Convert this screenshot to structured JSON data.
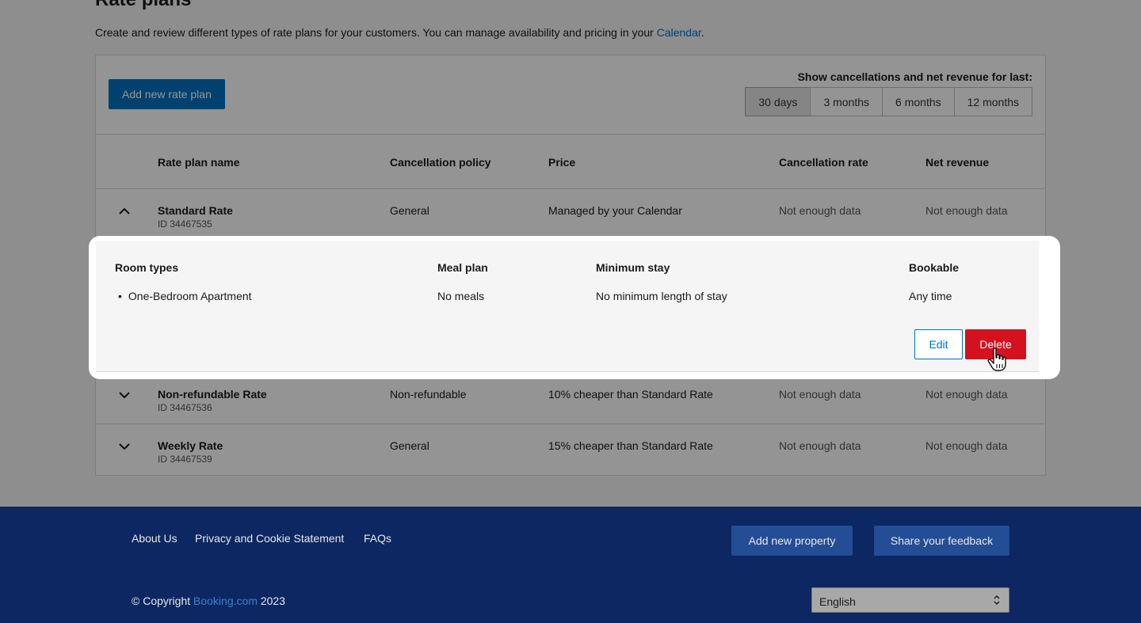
{
  "page": {
    "title": "Rate plans",
    "description_before": "Create and review different types of rate plans for your customers. You can manage availability and pricing in your ",
    "description_link": "Calendar",
    "description_after": "."
  },
  "toolbar": {
    "add_label": "Add new rate plan",
    "period_label": "Show cancellations and net revenue for last:",
    "periods": [
      "30 days",
      "3 months",
      "6 months",
      "12 months"
    ],
    "active_period": "30 days"
  },
  "table": {
    "headers": {
      "name": "Rate plan name",
      "policy": "Cancellation policy",
      "price": "Price",
      "rate": "Cancellation rate",
      "revenue": "Net revenue"
    },
    "rows": [
      {
        "name": "Standard Rate",
        "id": "ID 34467535",
        "policy": "General",
        "price": "Managed by your Calendar",
        "rate": "Not enough data",
        "revenue": "Not enough data",
        "expanded": true
      },
      {
        "name": "Non-refundable Rate",
        "id": "ID 34467536",
        "policy": "Non-refundable",
        "price": "10% cheaper than Standard Rate",
        "rate": "Not enough data",
        "revenue": "Not enough data",
        "expanded": false
      },
      {
        "name": "Weekly Rate",
        "id": "ID 34467539",
        "policy": "General",
        "price": "15% cheaper than Standard Rate",
        "rate": "Not enough data",
        "revenue": "Not enough data",
        "expanded": false
      }
    ]
  },
  "detail": {
    "headers": {
      "room_types": "Room types",
      "meal_plan": "Meal plan",
      "min_stay": "Minimum stay",
      "bookable": "Bookable"
    },
    "room_types": [
      "One-Bedroom Apartment"
    ],
    "meal_plan": "No meals",
    "min_stay": "No minimum length of stay",
    "bookable": "Any time",
    "edit_label": "Edit",
    "delete_label": "Delete"
  },
  "footer": {
    "links": [
      "About Us",
      "Privacy and Cookie Statement",
      "FAQs"
    ],
    "add_property_label": "Add new property",
    "feedback_label": "Share your feedback",
    "copyright_prefix": "© Copyright ",
    "copyright_brand": "Booking.com",
    "copyright_year": " 2023",
    "language": "English"
  },
  "colors": {
    "primary": "#0071c2",
    "danger": "#d4111e",
    "footer_bg": "#0c2761"
  },
  "icons": {
    "collapse": "chevron-up-icon",
    "expand": "chevron-down-icon",
    "cursor": "hand-pointer-icon",
    "select": "select-arrows-icon"
  }
}
